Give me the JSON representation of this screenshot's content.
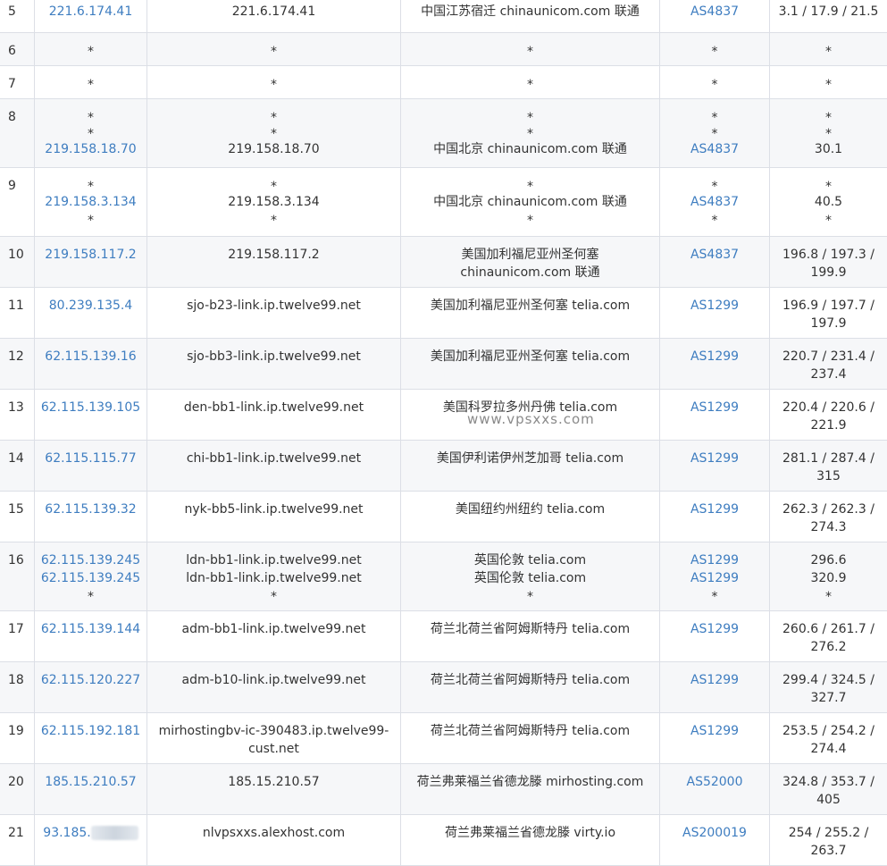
{
  "rows": [
    {
      "n": "5",
      "ip": [
        {
          "t": "221.6.174.41"
        }
      ],
      "host": [
        {
          "t": "221.6.174.41"
        }
      ],
      "loc": [
        {
          "t": "中国江苏宿迁 chinaunicom.com 联通"
        }
      ],
      "asn": [
        {
          "t": "AS4837"
        }
      ],
      "lat": [
        {
          "t": "3.1 / 17.9 / 21.5"
        }
      ]
    },
    {
      "n": "6",
      "ip": [
        {
          "t": "*"
        }
      ],
      "host": [
        {
          "t": "*"
        }
      ],
      "loc": [
        {
          "t": "*"
        }
      ],
      "asn": [
        {
          "t": "*"
        }
      ],
      "lat": [
        {
          "t": "*"
        }
      ]
    },
    {
      "n": "7",
      "ip": [
        {
          "t": "*"
        }
      ],
      "host": [
        {
          "t": "*"
        }
      ],
      "loc": [
        {
          "t": "*"
        }
      ],
      "asn": [
        {
          "t": "*"
        }
      ],
      "lat": [
        {
          "t": "*"
        }
      ]
    },
    {
      "n": "8",
      "ip": [
        {
          "t": "*"
        },
        {
          "t": "*"
        },
        {
          "t": "219.158.18.70"
        }
      ],
      "host": [
        {
          "t": "*"
        },
        {
          "t": "*"
        },
        {
          "t": "219.158.18.70"
        }
      ],
      "loc": [
        {
          "t": "*"
        },
        {
          "t": "*"
        },
        {
          "t": "中国北京 chinaunicom.com 联通"
        }
      ],
      "asn": [
        {
          "t": "*"
        },
        {
          "t": "*"
        },
        {
          "t": "AS4837"
        }
      ],
      "lat": [
        {
          "t": "*"
        },
        {
          "t": "*"
        },
        {
          "t": "30.1"
        }
      ]
    },
    {
      "n": "9",
      "ip": [
        {
          "t": "*"
        },
        {
          "t": "219.158.3.134"
        },
        {
          "t": "*"
        }
      ],
      "host": [
        {
          "t": "*"
        },
        {
          "t": "219.158.3.134"
        },
        {
          "t": "*"
        }
      ],
      "loc": [
        {
          "t": "*"
        },
        {
          "t": "中国北京 chinaunicom.com 联通"
        },
        {
          "t": "*"
        }
      ],
      "asn": [
        {
          "t": "*"
        },
        {
          "t": "AS4837"
        },
        {
          "t": "*"
        }
      ],
      "lat": [
        {
          "t": "*"
        },
        {
          "t": "40.5"
        },
        {
          "t": "*"
        }
      ]
    },
    {
      "n": "10",
      "ip": [
        {
          "t": "219.158.117.2"
        }
      ],
      "host": [
        {
          "t": "219.158.117.2"
        }
      ],
      "loc": [
        {
          "t": "美国加利福尼亚州圣何塞"
        },
        {
          "t": "chinaunicom.com 联通"
        }
      ],
      "asn": [
        {
          "t": "AS4837"
        }
      ],
      "lat": [
        {
          "t": "196.8 / 197.3 /"
        },
        {
          "t": "199.9"
        }
      ]
    },
    {
      "n": "11",
      "ip": [
        {
          "t": "80.239.135.4"
        }
      ],
      "host": [
        {
          "t": "sjo-b23-link.ip.twelve99.net"
        }
      ],
      "loc": [
        {
          "t": "美国加利福尼亚州圣何塞 telia.com"
        }
      ],
      "asn": [
        {
          "t": "AS1299"
        }
      ],
      "lat": [
        {
          "t": "196.9 / 197.7 /"
        },
        {
          "t": "197.9"
        }
      ]
    },
    {
      "n": "12",
      "ip": [
        {
          "t": "62.115.139.16"
        }
      ],
      "host": [
        {
          "t": "sjo-bb3-link.ip.twelve99.net"
        }
      ],
      "loc": [
        {
          "t": "美国加利福尼亚州圣何塞 telia.com"
        }
      ],
      "asn": [
        {
          "t": "AS1299"
        }
      ],
      "lat": [
        {
          "t": "220.7 / 231.4 /"
        },
        {
          "t": "237.4"
        }
      ]
    },
    {
      "n": "13",
      "ip": [
        {
          "t": "62.115.139.105"
        }
      ],
      "host": [
        {
          "t": "den-bb1-link.ip.twelve99.net"
        }
      ],
      "loc": [
        {
          "t": "美国科罗拉多州丹佛 telia.com"
        }
      ],
      "asn": [
        {
          "t": "AS1299"
        }
      ],
      "lat": [
        {
          "t": "220.4 / 220.6 /"
        },
        {
          "t": "221.9"
        }
      ]
    },
    {
      "n": "14",
      "ip": [
        {
          "t": "62.115.115.77"
        }
      ],
      "host": [
        {
          "t": "chi-bb1-link.ip.twelve99.net"
        }
      ],
      "loc": [
        {
          "t": "美国伊利诺伊州芝加哥 telia.com"
        }
      ],
      "asn": [
        {
          "t": "AS1299"
        }
      ],
      "lat": [
        {
          "t": "281.1 / 287.4 /"
        },
        {
          "t": "315"
        }
      ]
    },
    {
      "n": "15",
      "ip": [
        {
          "t": "62.115.139.32"
        }
      ],
      "host": [
        {
          "t": "nyk-bb5-link.ip.twelve99.net"
        }
      ],
      "loc": [
        {
          "t": "美国纽约州纽约 telia.com"
        }
      ],
      "asn": [
        {
          "t": "AS1299"
        }
      ],
      "lat": [
        {
          "t": "262.3 / 262.3 /"
        },
        {
          "t": "274.3"
        }
      ]
    },
    {
      "n": "16",
      "ip": [
        {
          "t": "62.115.139.245"
        },
        {
          "t": "62.115.139.245"
        },
        {
          "t": "*"
        }
      ],
      "host": [
        {
          "t": "ldn-bb1-link.ip.twelve99.net"
        },
        {
          "t": "ldn-bb1-link.ip.twelve99.net"
        },
        {
          "t": "*"
        }
      ],
      "loc": [
        {
          "t": "英国伦敦 telia.com"
        },
        {
          "t": "英国伦敦 telia.com"
        },
        {
          "t": "*"
        }
      ],
      "asn": [
        {
          "t": "AS1299"
        },
        {
          "t": "AS1299"
        },
        {
          "t": "*"
        }
      ],
      "lat": [
        {
          "t": "296.6"
        },
        {
          "t": "320.9"
        },
        {
          "t": "*"
        }
      ]
    },
    {
      "n": "17",
      "ip": [
        {
          "t": "62.115.139.144"
        }
      ],
      "host": [
        {
          "t": "adm-bb1-link.ip.twelve99.net"
        }
      ],
      "loc": [
        {
          "t": "荷兰北荷兰省阿姆斯特丹 telia.com"
        }
      ],
      "asn": [
        {
          "t": "AS1299"
        }
      ],
      "lat": [
        {
          "t": "260.6 / 261.7 /"
        },
        {
          "t": "276.2"
        }
      ]
    },
    {
      "n": "18",
      "ip": [
        {
          "t": "62.115.120.227"
        }
      ],
      "host": [
        {
          "t": "adm-b10-link.ip.twelve99.net"
        }
      ],
      "loc": [
        {
          "t": "荷兰北荷兰省阿姆斯特丹 telia.com"
        }
      ],
      "asn": [
        {
          "t": "AS1299"
        }
      ],
      "lat": [
        {
          "t": "299.4 / 324.5 /"
        },
        {
          "t": "327.7"
        }
      ]
    },
    {
      "n": "19",
      "ip": [
        {
          "t": "62.115.192.181"
        }
      ],
      "host": [
        {
          "t": "mirhostingbv-ic-390483.ip.twelve99-"
        },
        {
          "t": "cust.net"
        }
      ],
      "loc": [
        {
          "t": "荷兰北荷兰省阿姆斯特丹 telia.com"
        }
      ],
      "asn": [
        {
          "t": "AS1299"
        }
      ],
      "lat": [
        {
          "t": "253.5 / 254.2 /"
        },
        {
          "t": "274.4"
        }
      ]
    },
    {
      "n": "20",
      "ip": [
        {
          "t": "185.15.210.57"
        }
      ],
      "host": [
        {
          "t": "185.15.210.57"
        }
      ],
      "loc": [
        {
          "t": "荷兰弗莱福兰省德龙滕 mirhosting.com"
        }
      ],
      "asn": [
        {
          "t": "AS52000"
        }
      ],
      "lat": [
        {
          "t": "324.8 / 353.7 /"
        },
        {
          "t": "405"
        }
      ]
    },
    {
      "n": "21",
      "ip": [
        {
          "t": "93.185.",
          "blur": true
        }
      ],
      "host": [
        {
          "t": "nlvpsxxs.alexhost.com"
        }
      ],
      "loc": [
        {
          "t": "荷兰弗莱福兰省德龙滕 virty.io"
        }
      ],
      "asn": [
        {
          "t": "AS200019"
        }
      ],
      "lat": [
        {
          "t": "254 / 255.2 /"
        },
        {
          "t": "263.7"
        }
      ]
    }
  ],
  "watermark": "www.vpsxxs.com",
  "colors": {
    "link": "#3e7dc0",
    "text": "#333333",
    "border": "#dcdfe6",
    "alt_row": "#f6f7f9"
  }
}
